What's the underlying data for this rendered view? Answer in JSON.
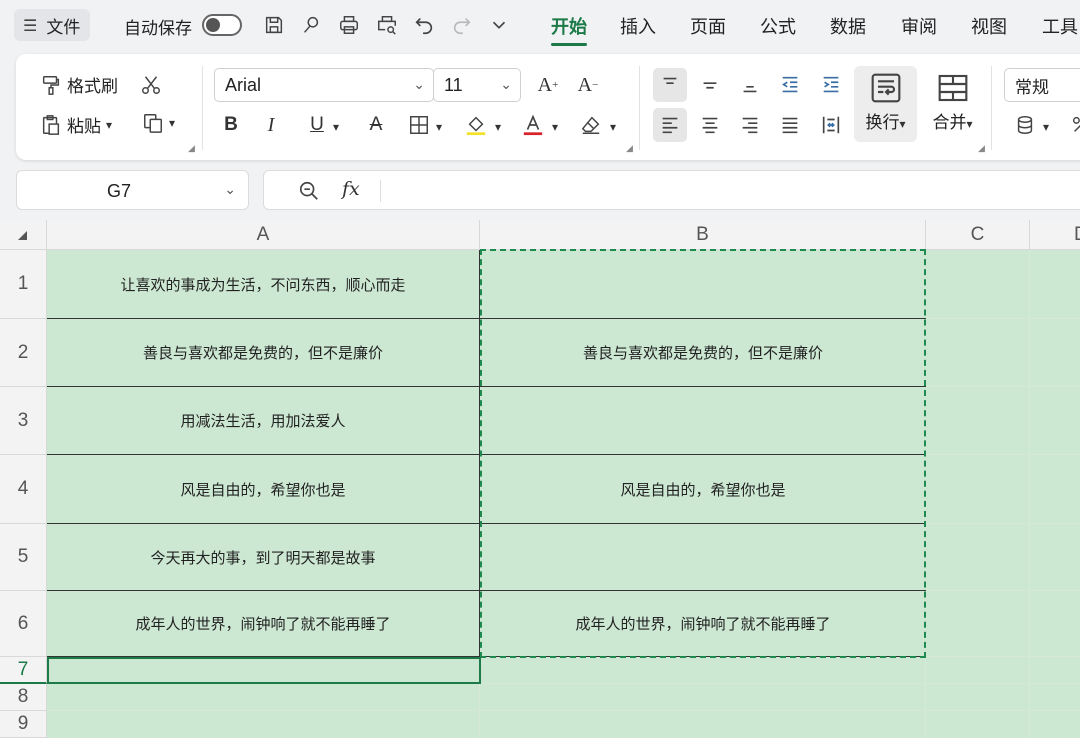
{
  "menubar": {
    "file_label": "文件",
    "autosave_label": "自动保存",
    "autosave_on": false,
    "quick_icons": [
      "save-icon",
      "format-painter-icon",
      "print-icon",
      "print-preview-icon",
      "undo-icon",
      "redo-icon",
      "more-chevron-icon"
    ],
    "tabs": [
      "开始",
      "插入",
      "页面",
      "公式",
      "数据",
      "审阅",
      "视图",
      "工具"
    ],
    "active_tab": "开始"
  },
  "ribbon": {
    "format_painter_label": "格式刷",
    "paste_label": "粘贴",
    "font_name": "Arial",
    "font_size": "11",
    "wrap_label": "换行",
    "merge_label": "合并",
    "number_format": "常规"
  },
  "formula_bar": {
    "cell_ref": "G7",
    "fx_label": "fx",
    "formula": ""
  },
  "grid": {
    "columns": [
      "A",
      "B",
      "C",
      "D"
    ],
    "rows": [
      "1",
      "2",
      "3",
      "4",
      "5",
      "6",
      "7",
      "8",
      "9"
    ],
    "active_row": "7",
    "cells": {
      "A1": "让喜欢的事成为生活，不问东西，顺心而走",
      "A2": "善良与喜欢都是免费的，但不是廉价",
      "A3": "用减法生活，用加法爱人",
      "A4": "风是自由的，希望你也是",
      "A5": "今天再大的事，到了明天都是故事",
      "A6": "成年人的世界，闹钟响了就不能再睡了",
      "B1": "",
      "B2": "善良与喜欢都是免费的，但不是廉价",
      "B3": "",
      "B4": "风是自由的，希望你也是",
      "B5": "",
      "B6": "成年人的世界，闹钟响了就不能再睡了"
    }
  },
  "colors": {
    "accent": "#1b7a47",
    "cell_fill": "#cde8d2",
    "marquee": "#1e8a50"
  }
}
